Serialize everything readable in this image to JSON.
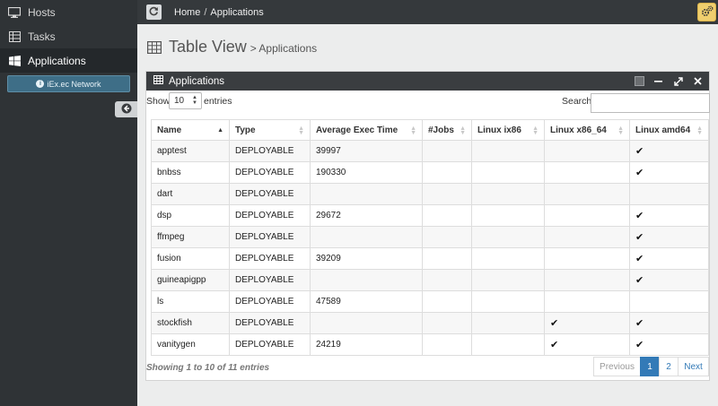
{
  "sidebar": {
    "items": [
      {
        "label": "Hosts",
        "icon": "monitor-icon"
      },
      {
        "label": "Tasks",
        "icon": "table-icon"
      },
      {
        "label": "Applications",
        "icon": "windows-icon"
      }
    ],
    "network_button": "iEx.ec Network"
  },
  "topbar": {
    "breadcrumb": [
      "Home",
      "/",
      "Applications"
    ]
  },
  "page": {
    "title": "Table View",
    "subtitle": "> Applications"
  },
  "panel": {
    "title": "Applications"
  },
  "controls": {
    "show_label": "Show",
    "length_value": "10",
    "entries_label": "entries",
    "search_label": "Search:",
    "search_value": ""
  },
  "table": {
    "columns": [
      "Name",
      "Type",
      "Average Exec Time",
      "#Jobs",
      "Linux ix86",
      "Linux x86_64",
      "Linux amd64"
    ],
    "check_mark": "✔",
    "rows": [
      {
        "name": "apptest",
        "type": "DEPLOYABLE",
        "avg": "39997",
        "jobs": "",
        "ix86": "",
        "x86_64": "",
        "amd64": "✔"
      },
      {
        "name": "bnbss",
        "type": "DEPLOYABLE",
        "avg": "190330",
        "jobs": "",
        "ix86": "",
        "x86_64": "",
        "amd64": "✔"
      },
      {
        "name": "dart",
        "type": "DEPLOYABLE",
        "avg": "",
        "jobs": "",
        "ix86": "",
        "x86_64": "",
        "amd64": ""
      },
      {
        "name": "dsp",
        "type": "DEPLOYABLE",
        "avg": "29672",
        "jobs": "",
        "ix86": "",
        "x86_64": "",
        "amd64": "✔"
      },
      {
        "name": "ffmpeg",
        "type": "DEPLOYABLE",
        "avg": "",
        "jobs": "",
        "ix86": "",
        "x86_64": "",
        "amd64": "✔"
      },
      {
        "name": "fusion",
        "type": "DEPLOYABLE",
        "avg": "39209",
        "jobs": "",
        "ix86": "",
        "x86_64": "",
        "amd64": "✔"
      },
      {
        "name": "guineapigpp",
        "type": "DEPLOYABLE",
        "avg": "",
        "jobs": "",
        "ix86": "",
        "x86_64": "",
        "amd64": "✔"
      },
      {
        "name": "ls",
        "type": "DEPLOYABLE",
        "avg": "47589",
        "jobs": "",
        "ix86": "",
        "x86_64": "",
        "amd64": ""
      },
      {
        "name": "stockfish",
        "type": "DEPLOYABLE",
        "avg": "",
        "jobs": "",
        "ix86": "",
        "x86_64": "✔",
        "amd64": "✔"
      },
      {
        "name": "vanitygen",
        "type": "DEPLOYABLE",
        "avg": "24219",
        "jobs": "",
        "ix86": "",
        "x86_64": "✔",
        "amd64": "✔"
      }
    ]
  },
  "footer": {
    "info": "Showing 1 to 10 of 11 entries",
    "pagination": [
      "Previous",
      "1",
      "2",
      "Next"
    ],
    "current_page": "1"
  },
  "colors": {
    "sidebar_bg": "#2f3336",
    "panel_header_bg": "#3a3d40",
    "accent": "#337ab7",
    "network_button": "#3e6e87",
    "settings_button": "#f0cf6e"
  }
}
